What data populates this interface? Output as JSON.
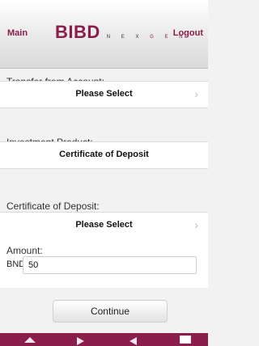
{
  "header": {
    "main_label": "Main",
    "logo_text": "BIBD",
    "logo_sub": "NEXGEN",
    "logout_label": "Logout"
  },
  "transfer": {
    "label": "Transfer from Account:",
    "value": "Please Select"
  },
  "investment": {
    "label": "Investment Product:",
    "value": "Certificate of Deposit"
  },
  "certificate": {
    "label": "Certificate of Deposit:",
    "value": "Please Select"
  },
  "amount": {
    "label": "Amount:",
    "currency": "BND",
    "value": "50"
  },
  "actions": {
    "continue_label": "Continue"
  },
  "icons": {
    "chevron": "›"
  },
  "colors": {
    "brand": "#8a1d4c"
  }
}
